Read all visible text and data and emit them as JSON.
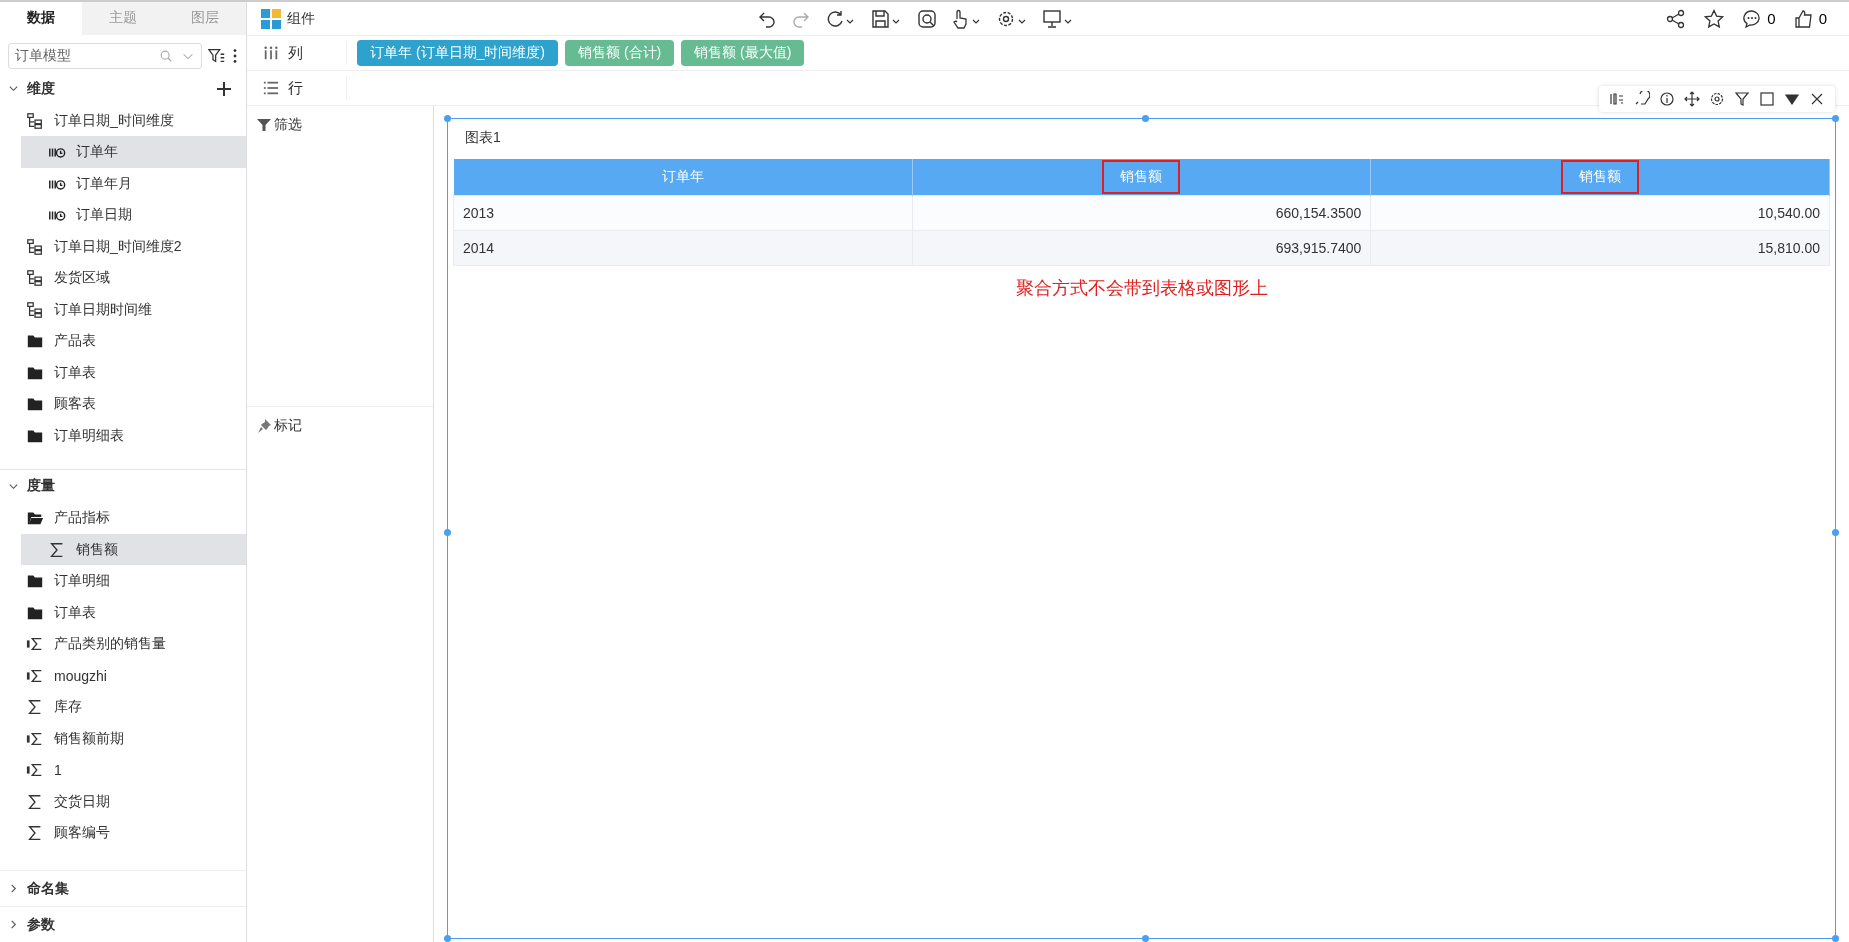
{
  "tabs": [
    {
      "label": "数据",
      "selected": true
    },
    {
      "label": "主题",
      "selected": false
    },
    {
      "label": "图层",
      "selected": false
    }
  ],
  "model_select": {
    "value": "订单模型"
  },
  "dimensions": {
    "title": "维度",
    "expanded": true,
    "items": [
      {
        "label": "订单日期_时间维度",
        "kind": "hierarchy",
        "selected": false,
        "children": [
          {
            "label": "订单年",
            "kind": "level",
            "selected": true
          },
          {
            "label": "订单年月",
            "kind": "level",
            "selected": false
          },
          {
            "label": "订单日期",
            "kind": "level",
            "selected": false
          }
        ]
      },
      {
        "label": "订单日期_时间维度2",
        "kind": "hierarchy",
        "selected": false
      },
      {
        "label": "发货区域",
        "kind": "hierarchy",
        "selected": false
      },
      {
        "label": "订单日期时间维",
        "kind": "hierarchy",
        "selected": false
      },
      {
        "label": "产品表",
        "kind": "folder",
        "selected": false
      },
      {
        "label": "订单表",
        "kind": "folder",
        "selected": false
      },
      {
        "label": "顾客表",
        "kind": "folder",
        "selected": false
      },
      {
        "label": "订单明细表",
        "kind": "folder",
        "selected": false
      }
    ]
  },
  "measures": {
    "title": "度量",
    "expanded": true,
    "items": [
      {
        "label": "产品指标",
        "kind": "folder-open",
        "selected": false,
        "children": [
          {
            "label": "销售额",
            "kind": "sigma",
            "selected": true
          }
        ]
      },
      {
        "label": "订单明细",
        "kind": "folder",
        "selected": false
      },
      {
        "label": "订单表",
        "kind": "folder",
        "selected": false
      },
      {
        "label": "产品类别的销售量",
        "kind": "calc",
        "selected": false
      },
      {
        "label": "mougzhi",
        "kind": "calc",
        "selected": false
      },
      {
        "label": "库存",
        "kind": "sigma",
        "selected": false
      },
      {
        "label": "销售额前期",
        "kind": "calc",
        "selected": false
      },
      {
        "label": "1",
        "kind": "calc",
        "selected": false
      },
      {
        "label": "交货日期",
        "kind": "sigma",
        "selected": false
      },
      {
        "label": "顾客编号",
        "kind": "sigma",
        "selected": false
      }
    ]
  },
  "sections": [
    {
      "title": "命名集",
      "expanded": false
    },
    {
      "title": "参数",
      "expanded": false
    }
  ],
  "toolbar": {
    "component_label": "组件",
    "comment_count": "0",
    "like_count": "0"
  },
  "shelves": [
    {
      "kind": "columns",
      "label": "列",
      "pills": [
        {
          "label": "订单年 (订单日期_时间维度)",
          "color": "#2ca2cc"
        },
        {
          "label": "销售额 (合计)",
          "color": "#66bb93"
        },
        {
          "label": "销售额 (最大值)",
          "color": "#66bb93"
        }
      ]
    },
    {
      "kind": "rows",
      "label": "行"
    }
  ],
  "filter_label": "筛选",
  "marks_label": "标记",
  "chart": {
    "title": "图表1",
    "columns": [
      {
        "label": "订单年",
        "highlighted": false
      },
      {
        "label": "销售额",
        "highlighted": true
      },
      {
        "label": "销售额",
        "highlighted": true
      }
    ],
    "rows": [
      [
        "2013",
        "660,154.3500",
        "10,540.00"
      ],
      [
        "2014",
        "693,915.7400",
        "15,810.00"
      ]
    ],
    "note": "聚合方式不会带到表格或图形上"
  }
}
